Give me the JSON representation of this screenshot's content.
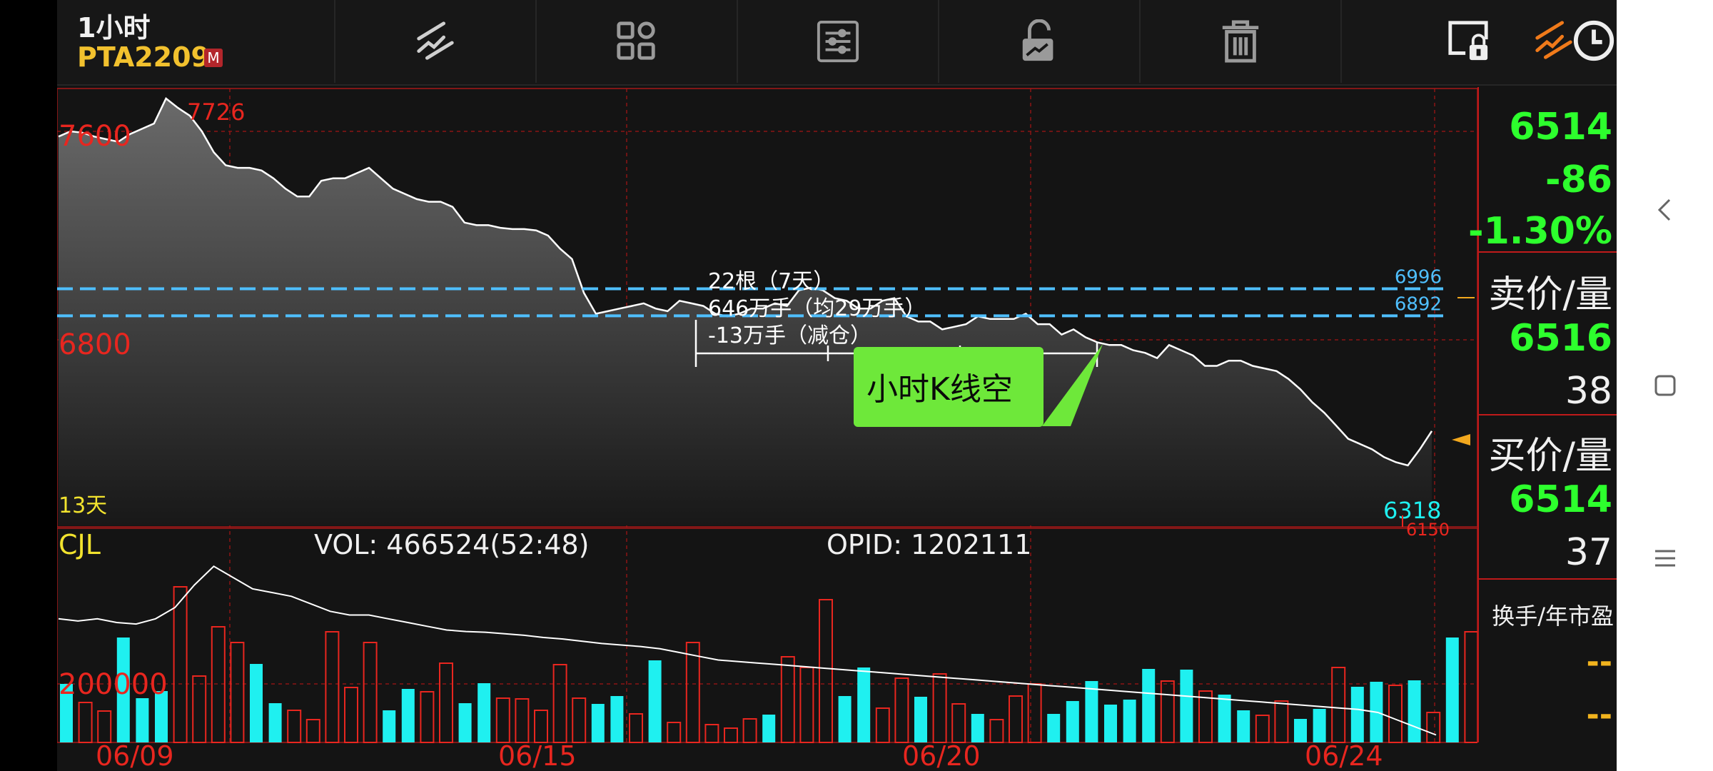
{
  "header": {
    "period": "1小时",
    "symbol": "PTA2209",
    "badge": "M",
    "tools": [
      "draw-line-icon",
      "layout-grid-icon",
      "settings-sliders-icon",
      "unlock-icon",
      "trash-icon",
      "lock-screen-icon",
      "draw-line-active-icon",
      "clock-icon"
    ]
  },
  "price_chart": {
    "y_labels": {
      "high": "7600",
      "low": "6800"
    },
    "max_label": "7726",
    "min_label": "6318",
    "range_label": "13天",
    "lines": [
      {
        "label": "6996",
        "value": 6996
      },
      {
        "label": "6892",
        "value": 6892
      }
    ],
    "bottom_partial_label": "6150",
    "stats": {
      "line1": "22根（7天）",
      "line2": "646万手（均29万手）",
      "line3": "-13万手（减仓）"
    },
    "note": "小时K线空",
    "chart_data": {
      "type": "area",
      "series": [
        {
          "values": [
            7580,
            7600,
            7595,
            7580,
            7570,
            7560,
            7590,
            7610,
            7630,
            7726,
            7690,
            7660,
            7600,
            7520,
            7470,
            7460,
            7460,
            7450,
            7420,
            7380,
            7350,
            7350,
            7410,
            7420,
            7420,
            7440,
            7460,
            7420,
            7380,
            7360,
            7340,
            7330,
            7330,
            7310,
            7250,
            7240,
            7240,
            7230,
            7225,
            7225,
            7220,
            7200,
            7150,
            7110,
            6980,
            6900,
            6910,
            6920,
            6930,
            6940,
            6920,
            6910,
            6950,
            6940,
            6930,
            6900,
            6890,
            6900,
            6920,
            6920,
            6940,
            6930,
            6990,
            7000,
            6990,
            6960,
            6950,
            6920,
            6920,
            6950,
            6960,
            6890,
            6870,
            6870,
            6840,
            6850,
            6860,
            6890,
            6880,
            6880,
            6880,
            6900,
            6860,
            6860,
            6820,
            6840,
            6810,
            6790,
            6780,
            6780,
            6760,
            6750,
            6730,
            6780,
            6760,
            6740,
            6700,
            6700,
            6720,
            6720,
            6700,
            6690,
            6680,
            6650,
            6610,
            6560,
            6520,
            6470,
            6420,
            6400,
            6380,
            6350,
            6330,
            6318,
            6380,
            6450
          ]
        }
      ],
      "x_ticks": [
        "06/09",
        "06/15",
        "06/20",
        "06/24"
      ],
      "y_ticks": [
        "7600",
        "6800"
      ]
    }
  },
  "volume_chart": {
    "title": "CJL",
    "vol_label": "VOL: 466524(52:48)",
    "opid_label": "OPID: 1202111",
    "y_label": "200000",
    "chart_data": {
      "type": "bar",
      "bars": [
        {
          "v": 82,
          "up": true
        },
        {
          "v": 56,
          "up": false
        },
        {
          "v": 44,
          "up": false
        },
        {
          "v": 147,
          "up": true
        },
        {
          "v": 62,
          "up": true
        },
        {
          "v": 72,
          "up": true
        },
        {
          "v": 218,
          "up": false
        },
        {
          "v": 93,
          "up": false
        },
        {
          "v": 162,
          "up": false
        },
        {
          "v": 140,
          "up": false
        },
        {
          "v": 110,
          "up": true
        },
        {
          "v": 55,
          "up": true
        },
        {
          "v": 45,
          "up": false
        },
        {
          "v": 32,
          "up": false
        },
        {
          "v": 155,
          "up": false
        },
        {
          "v": 77,
          "up": false
        },
        {
          "v": 140,
          "up": false
        },
        {
          "v": 45,
          "up": true
        },
        {
          "v": 75,
          "up": true
        },
        {
          "v": 71,
          "up": false
        },
        {
          "v": 111,
          "up": false
        },
        {
          "v": 55,
          "up": true
        },
        {
          "v": 83,
          "up": true
        },
        {
          "v": 62,
          "up": false
        },
        {
          "v": 61,
          "up": false
        },
        {
          "v": 45,
          "up": false
        },
        {
          "v": 109,
          "up": false
        },
        {
          "v": 62,
          "up": false
        },
        {
          "v": 54,
          "up": true
        },
        {
          "v": 65,
          "up": true
        },
        {
          "v": 40,
          "up": false
        },
        {
          "v": 115,
          "up": true
        },
        {
          "v": 28,
          "up": false
        },
        {
          "v": 140,
          "up": false
        },
        {
          "v": 25,
          "up": false
        },
        {
          "v": 20,
          "up": false
        },
        {
          "v": 33,
          "up": false
        },
        {
          "v": 39,
          "up": true
        },
        {
          "v": 120,
          "up": false
        },
        {
          "v": 105,
          "up": false
        },
        {
          "v": 200,
          "up": false
        },
        {
          "v": 65,
          "up": true
        },
        {
          "v": 105,
          "up": true
        },
        {
          "v": 48,
          "up": false
        },
        {
          "v": 90,
          "up": false
        },
        {
          "v": 64,
          "up": true
        },
        {
          "v": 96,
          "up": false
        },
        {
          "v": 54,
          "up": false
        },
        {
          "v": 40,
          "up": true
        },
        {
          "v": 32,
          "up": false
        },
        {
          "v": 65,
          "up": false
        },
        {
          "v": 82,
          "up": false
        },
        {
          "v": 40,
          "up": true
        },
        {
          "v": 58,
          "up": true
        },
        {
          "v": 86,
          "up": true
        },
        {
          "v": 53,
          "up": true
        },
        {
          "v": 60,
          "up": true
        },
        {
          "v": 103,
          "up": true
        },
        {
          "v": 86,
          "up": false
        },
        {
          "v": 102,
          "up": true
        },
        {
          "v": 72,
          "up": false
        },
        {
          "v": 67,
          "up": true
        },
        {
          "v": 45,
          "up": true
        },
        {
          "v": 38,
          "up": false
        },
        {
          "v": 58,
          "up": false
        },
        {
          "v": 33,
          "up": true
        },
        {
          "v": 47,
          "up": true
        },
        {
          "v": 105,
          "up": false
        },
        {
          "v": 78,
          "up": true
        },
        {
          "v": 85,
          "up": true
        },
        {
          "v": 80,
          "up": false
        },
        {
          "v": 87,
          "up": true
        },
        {
          "v": 42,
          "up": false
        },
        {
          "v": 147,
          "up": true
        },
        {
          "v": 155,
          "up": false
        },
        {
          "v": 90,
          "up": true
        },
        {
          "v": 117,
          "up": false
        },
        {
          "v": 84,
          "up": true
        }
      ],
      "ma": [
        165,
        162,
        165,
        160,
        158,
        165,
        180,
        210,
        235,
        220,
        205,
        200,
        195,
        185,
        175,
        170,
        170,
        165,
        160,
        155,
        150,
        148,
        147,
        145,
        143,
        140,
        138,
        135,
        132,
        130,
        128,
        125,
        120,
        115,
        110,
        108,
        106,
        104,
        102,
        100,
        98,
        96,
        94,
        92,
        90,
        88,
        86,
        84,
        82,
        80,
        78,
        76,
        74,
        72,
        70,
        68,
        66,
        64,
        62,
        60,
        58,
        56,
        54,
        52,
        50,
        48,
        46,
        44,
        40,
        30,
        20,
        10
      ]
    }
  },
  "side": {
    "last": "6514",
    "change": "-86",
    "change_pct": "-1.30%",
    "ask_label": "卖价/量",
    "ask_price": "6516",
    "ask_vol": "38",
    "bid_label": "买价/量",
    "bid_price": "6514",
    "bid_vol": "37",
    "turnover_label": "换手/年市盈",
    "turnover": "--",
    "pe": "--"
  },
  "colors": {
    "up": "#e8261f",
    "down": "#1ff0f0",
    "green": "#2dff2d",
    "yellow": "#f2e32e",
    "line": "#4fbfff"
  }
}
